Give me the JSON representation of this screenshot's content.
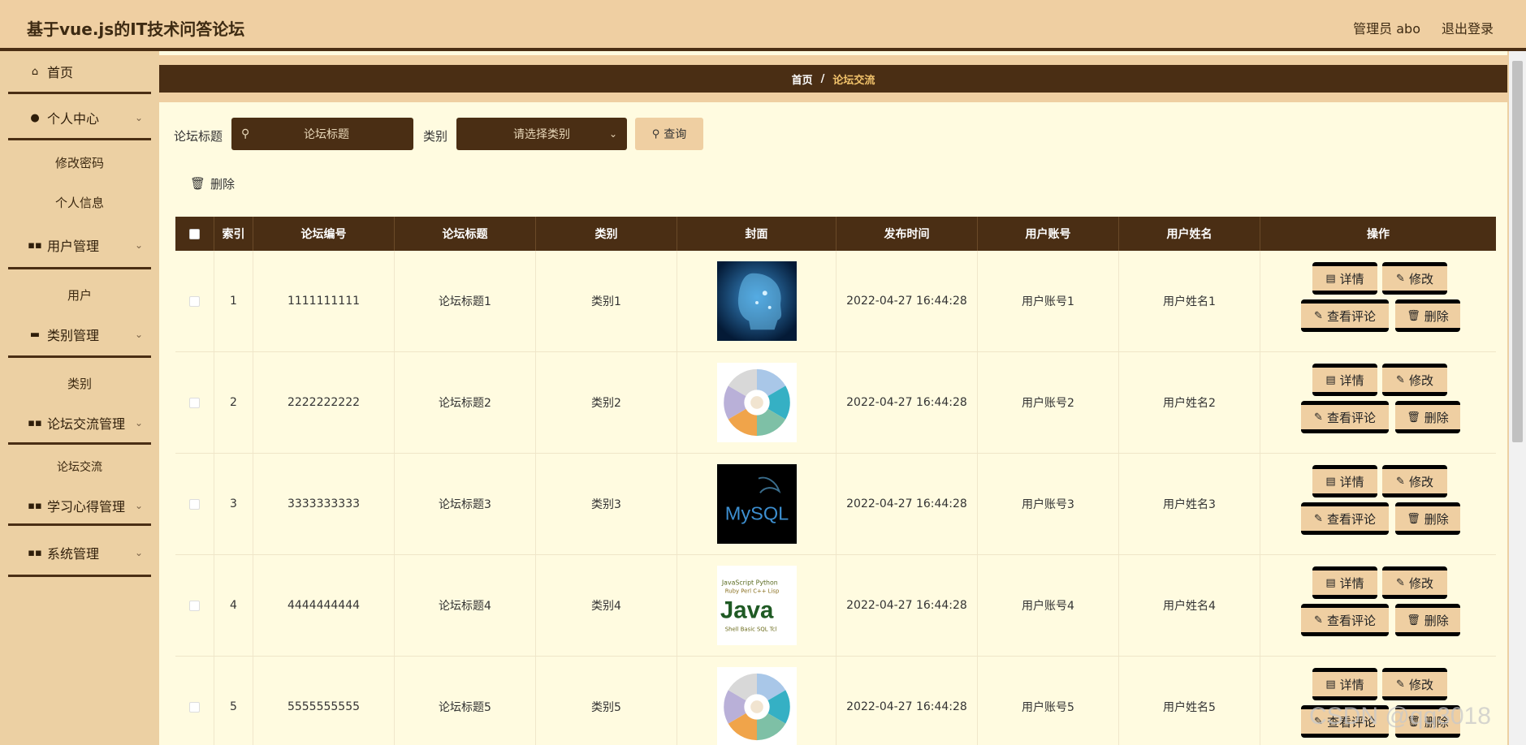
{
  "header": {
    "title": "基于vue.js的IT技术问答论坛",
    "admin": "管理员 abo",
    "logout": "退出登录"
  },
  "sidebar": {
    "items": [
      {
        "label": "首页",
        "icon": "home-icon"
      },
      {
        "label": "个人中心",
        "icon": "user-icon",
        "children": [
          "修改密码",
          "个人信息"
        ]
      },
      {
        "label": "用户管理",
        "icon": "grid-icon",
        "children": [
          "用户"
        ]
      },
      {
        "label": "类别管理",
        "icon": "monitor-icon",
        "children": [
          "类别"
        ]
      },
      {
        "label": "论坛交流管理",
        "icon": "grid-icon",
        "children": [
          "论坛交流"
        ]
      },
      {
        "label": "学习心得管理",
        "icon": "grid-icon"
      },
      {
        "label": "系统管理",
        "icon": "grid-icon"
      }
    ]
  },
  "breadcrumb": {
    "home": "首页",
    "sep": "/",
    "current": "论坛交流"
  },
  "search": {
    "title_label": "论坛标题",
    "title_placeholder": "论坛标题",
    "category_label": "类别",
    "category_placeholder": "请选择类别",
    "query_label": "查询",
    "delete_label": "删除"
  },
  "table": {
    "headers": [
      "索引",
      "论坛编号",
      "论坛标题",
      "类别",
      "封面",
      "发布时间",
      "用户账号",
      "用户姓名",
      "操作"
    ],
    "rows": [
      {
        "index": "1",
        "number": "1111111111",
        "title": "论坛标题1",
        "category": "类别1",
        "cover": "ai-head",
        "time": "2022-04-27 16:44:28",
        "account": "用户账号1",
        "name": "用户姓名1"
      },
      {
        "index": "2",
        "number": "2222222222",
        "title": "论坛标题2",
        "category": "类别2",
        "cover": "java-wheel",
        "time": "2022-04-27 16:44:28",
        "account": "用户账号2",
        "name": "用户姓名2"
      },
      {
        "index": "3",
        "number": "3333333333",
        "title": "论坛标题3",
        "category": "类别3",
        "cover": "mysql",
        "time": "2022-04-27 16:44:28",
        "account": "用户账号3",
        "name": "用户姓名3"
      },
      {
        "index": "4",
        "number": "4444444444",
        "title": "论坛标题4",
        "category": "类别4",
        "cover": "java-cloud",
        "time": "2022-04-27 16:44:28",
        "account": "用户账号4",
        "name": "用户姓名4"
      },
      {
        "index": "5",
        "number": "5555555555",
        "title": "论坛标题5",
        "category": "类别5",
        "cover": "java-wheel",
        "time": "2022-04-27 16:44:28",
        "account": "用户账号5",
        "name": "用户姓名5"
      }
    ],
    "actions": {
      "detail": "详情",
      "edit": "修改",
      "comments": "查看评论",
      "delete": "删除"
    }
  },
  "cover_art": {
    "mysql": "MySQL",
    "java": "Java"
  },
  "watermark": "CSDN @qq3018"
}
